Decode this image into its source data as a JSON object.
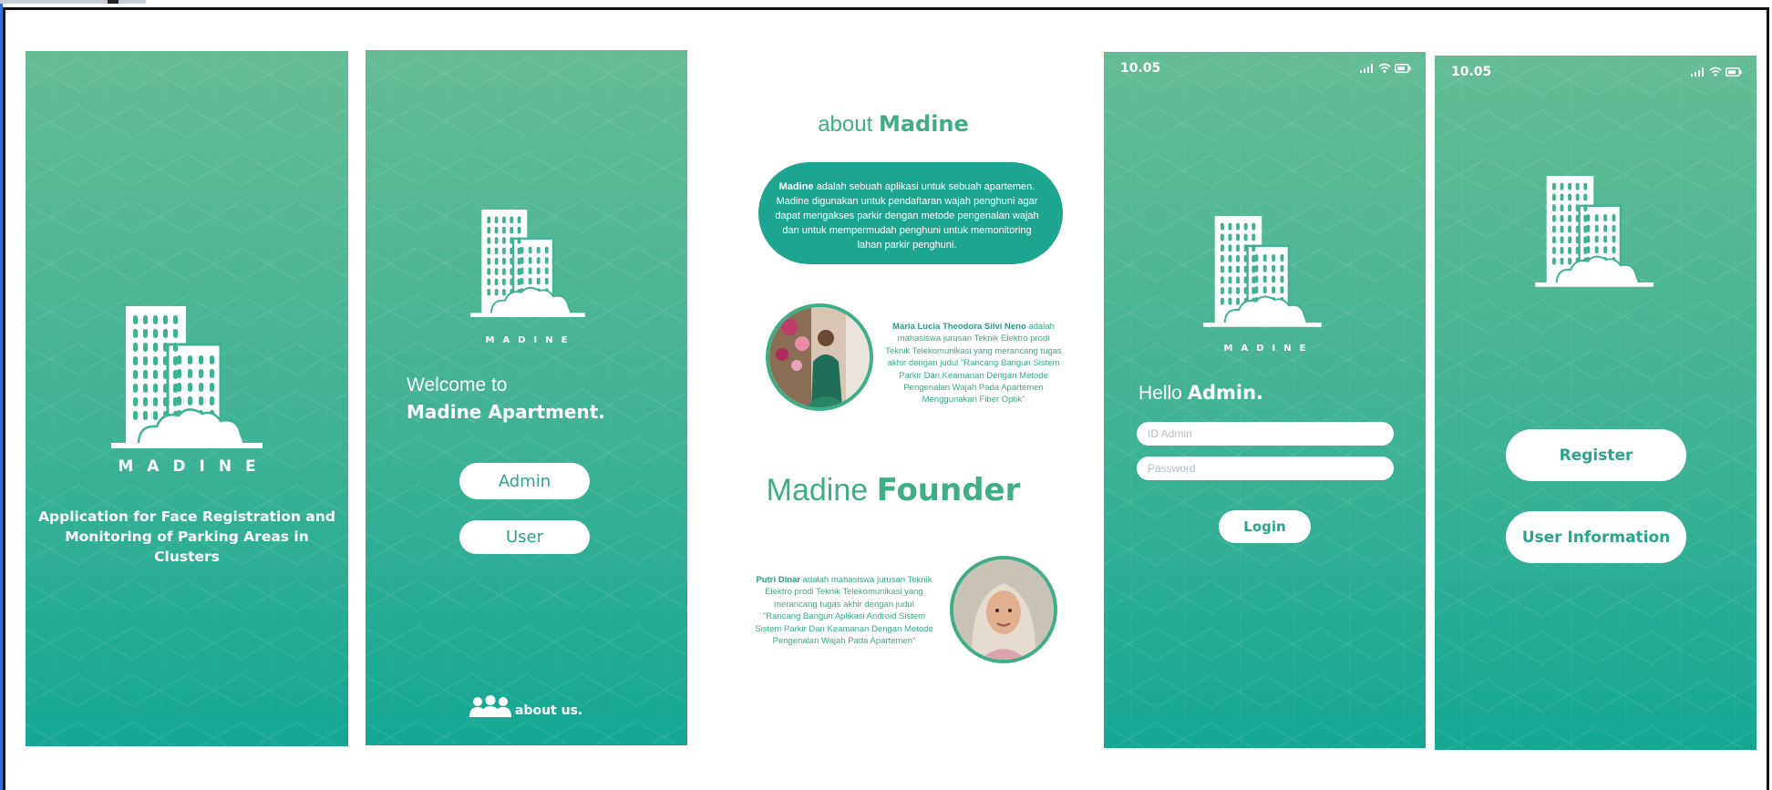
{
  "splash": {
    "brand": "MADINE",
    "tagline": "Application for Face Registration and Monitoring of Parking Areas in Clusters"
  },
  "welcome": {
    "brand": "MADINE",
    "line1": "Welcome to",
    "line2": "Madine Apartment.",
    "admin_label": "Admin",
    "user_label": "User",
    "about_link": "about us."
  },
  "about": {
    "title_prefix": "about",
    "title_brand": "Madine",
    "desc_brand": "Madine",
    "desc_rest": " adalah sebuah aplikasi  untuk sebuah apartemen. Madine digunakan untuk pendaftaran wajah penghuni agar dapat mengakses parkir dengan metode pengenalan wajah dan untuk mempermudah penghuni untuk memonitoring lahan parkir penghuni.",
    "person1_name": "Maria Lucia Theodora Silvi Neno",
    "person1_text": " adalah mahasiswa jurusan Teknik Elektro prodi Teknik Telekomunikasi yang merancang tugas akhir dengan judul \"Rancang Bangun Sistem Parkir Dan Keamanan Dengan Metode Pengenalan Wajah Pada Apartemen Menggunakan Fiber Optik\"",
    "founder_prefix": "Madine",
    "founder_bold": "Founder",
    "person2_name": "Putri Dinar",
    "person2_text": " adalah mahasiswa jurusan Teknik Elektro prodi Teknik Telekomunikasi yang merancang tugas akhir dengan judul \"Rancang Bangun Aplikasi Android Sistem Sistem Parkir Dan Keamanan Dengan Metode Pengenalan Wajah Pada Apartemen\""
  },
  "admin_login": {
    "time": "10.05",
    "brand": "MADINE",
    "hello": "Hello",
    "hello_bold": "Admin.",
    "id_placeholder": "ID Admin",
    "password_placeholder": "Password",
    "login_label": "Login"
  },
  "user_menu": {
    "time": "10.05",
    "register_label": "Register",
    "info_label": "User Information"
  },
  "colors": {
    "green_top": "#64bc95",
    "green_bottom": "#15a793",
    "accent_text": "#3fae88",
    "button_text": "#2aa58d"
  }
}
